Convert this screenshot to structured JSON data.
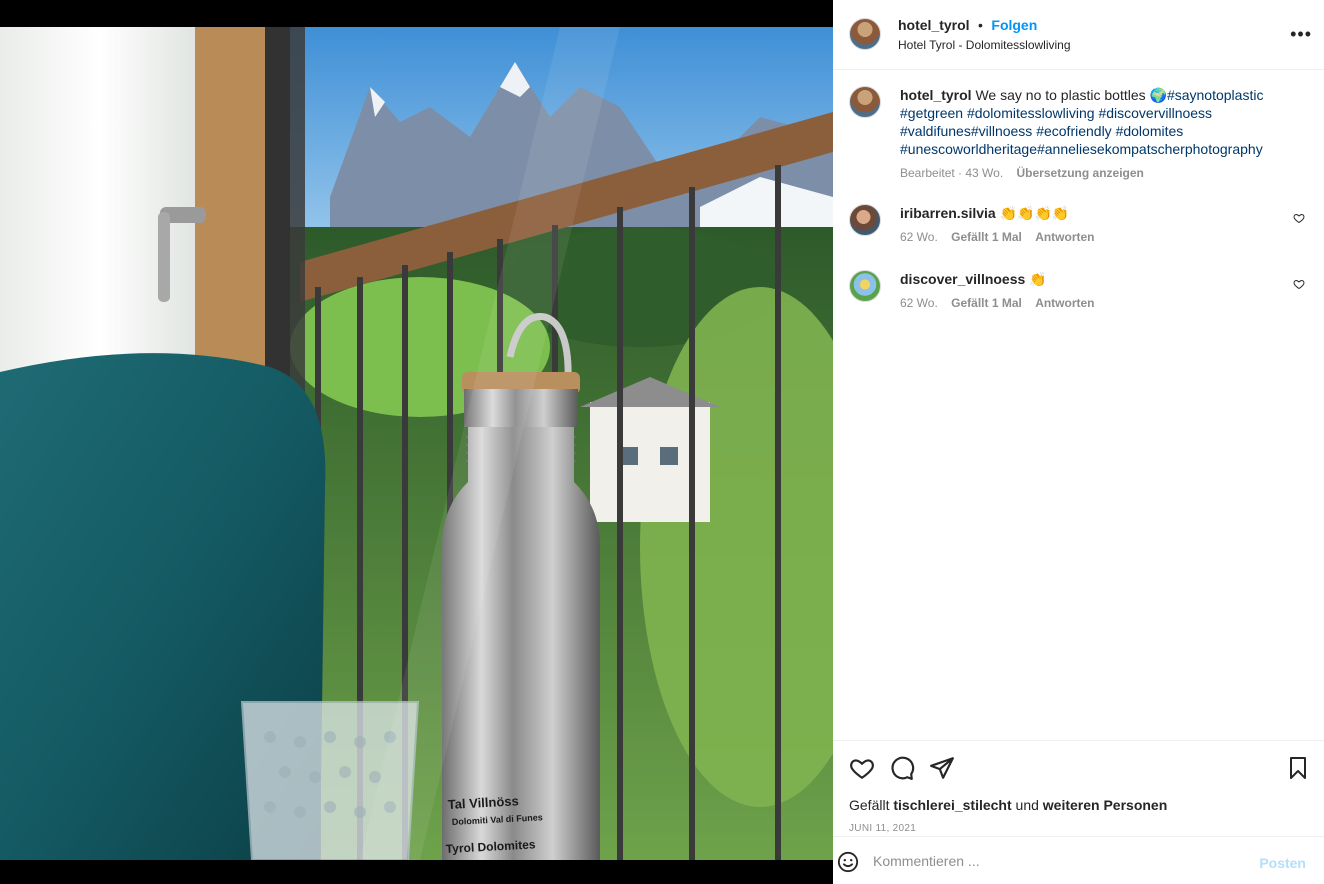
{
  "post": {
    "author": "hotel_tyrol",
    "separator": "•",
    "follow_label": "Folgen",
    "location": "Hotel Tyrol - Dolomitesslowliving",
    "more_icon": "more-horizontal-icon",
    "image": {
      "bottle_text_line1": "Tal Villnöss",
      "bottle_text_line2": "Dolomiti Val di Funes",
      "bottle_text_line3": "Tyrol Dolomites"
    }
  },
  "caption": {
    "author": "hotel_tyrol",
    "text": "We say no to plastic bottles 🌍",
    "hashtags_line1": "#saynotoplastic",
    "hashtags_line2": "#getgreen #dolomitesslowliving #discovervillnoess",
    "hashtags_line3": "#valdifunes#villnoess #ecofriendly #dolomites",
    "hashtags_line4": "#unescoworldheritage#anneliesekompatscherphotography",
    "meta": "Bearbeitet · 43 Wo.",
    "translate_label": "Übersetzung anzeigen"
  },
  "comments": [
    {
      "author": "iribarren.silvia",
      "text": "👏👏👏👏",
      "age": "62 Wo.",
      "likes": "Gefällt 1 Mal",
      "reply": "Antworten"
    },
    {
      "author": "discover_villnoess",
      "text": "👏",
      "age": "62 Wo.",
      "likes": "Gefällt 1 Mal",
      "reply": "Antworten"
    }
  ],
  "actions": {
    "like_icon": "heart-icon",
    "comment_icon": "comment-icon",
    "share_icon": "send-icon",
    "save_icon": "bookmark-icon",
    "liked_prefix": "Gefällt",
    "liked_user": "tischlerei_stilecht",
    "liked_middle": "und",
    "liked_others": "weiteren Personen",
    "date": "JUNI 11, 2021"
  },
  "composer": {
    "emoji_icon": "emoji-icon",
    "placeholder": "Kommentieren ...",
    "post_label": "Posten"
  },
  "colors": {
    "link_blue": "#0095f6",
    "hashtag_blue": "#00376b",
    "muted": "#8e8e8e",
    "text": "#262626"
  }
}
